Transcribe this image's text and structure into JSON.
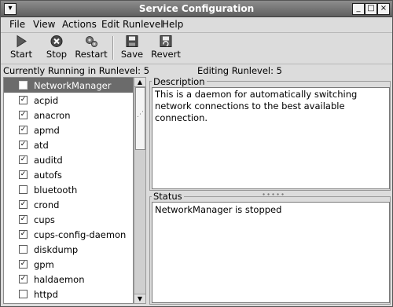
{
  "window": {
    "title": "Service Configuration"
  },
  "menu": {
    "file": "File",
    "view": "View",
    "actions": "Actions",
    "edit_runlevel": "Edit Runlevel",
    "help": "Help"
  },
  "toolbar": {
    "start": "Start",
    "stop": "Stop",
    "restart": "Restart",
    "save": "Save",
    "revert": "Revert"
  },
  "info": {
    "running": "Currently Running in Runlevel: 5",
    "editing": "Editing Runlevel: 5"
  },
  "services": [
    {
      "name": "NetworkManager",
      "checked": false,
      "selected": true
    },
    {
      "name": "acpid",
      "checked": true
    },
    {
      "name": "anacron",
      "checked": true
    },
    {
      "name": "apmd",
      "checked": true
    },
    {
      "name": "atd",
      "checked": true
    },
    {
      "name": "auditd",
      "checked": true
    },
    {
      "name": "autofs",
      "checked": true
    },
    {
      "name": "bluetooth",
      "checked": false
    },
    {
      "name": "crond",
      "checked": true
    },
    {
      "name": "cups",
      "checked": true
    },
    {
      "name": "cups-config-daemon",
      "checked": true
    },
    {
      "name": "diskdump",
      "checked": false
    },
    {
      "name": "gpm",
      "checked": true
    },
    {
      "name": "haldaemon",
      "checked": true
    },
    {
      "name": "httpd",
      "checked": false
    }
  ],
  "description": {
    "label": "Description",
    "text": "This is a daemon for automatically switching network connections to the best available connection."
  },
  "status": {
    "label": "Status",
    "text": "NetworkManager is stopped"
  },
  "colors": {
    "titlebar": "#6f6f6f",
    "selection": "#6b6b6b",
    "window_bg": "#dcdcdc"
  }
}
